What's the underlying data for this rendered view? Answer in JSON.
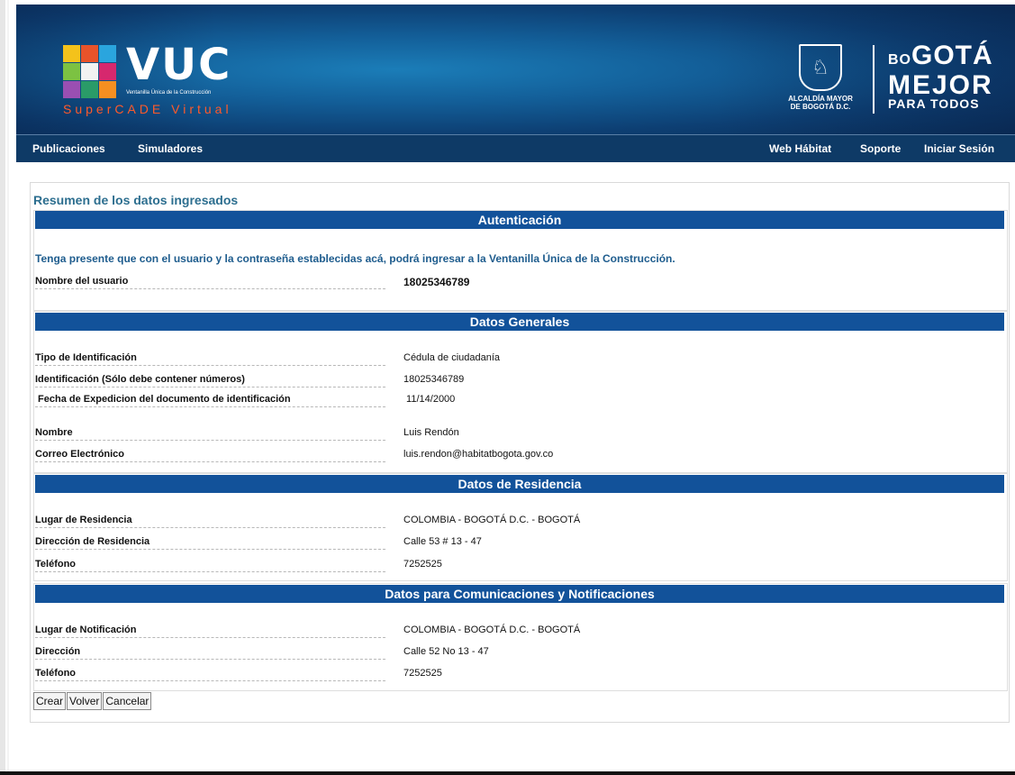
{
  "header": {
    "logo_text": "VUC",
    "logo_subtitle": "Ventanilla Única de la Construcción",
    "logo_tagline": "SuperCADE Virtual",
    "alcaldia": [
      "ALCALDÍA MAYOR",
      "DE BOGOTÁ D.C."
    ],
    "bogota": {
      "line1_small": "BO",
      "line1": "GOTÁ",
      "line2": "MEJOR",
      "line3": "PARA TODOS"
    }
  },
  "nav": {
    "left": [
      "Publicaciones",
      "Simuladores"
    ],
    "right": [
      "Web Hábitat",
      "Soporte",
      "Iniciar Sesión"
    ]
  },
  "summary_title": "Resumen de los datos ingresados",
  "sections": {
    "auth": {
      "title": "Autenticación",
      "notice": "Tenga presente que con el usuario y la contraseña establecidas acá, podrá ingresar a la Ventanilla Única de la Construcción.",
      "rows": [
        {
          "label": "Nombre del usuario",
          "value": "18025346789"
        }
      ]
    },
    "general": {
      "title": "Datos Generales",
      "rows": [
        {
          "label": "Tipo de Identificación",
          "value": "Cédula de ciudadanía"
        },
        {
          "label": "Identificación (Sólo debe contener números)",
          "value": "18025346789"
        },
        {
          "label": " Fecha de Expedicion del documento de identificación",
          "value": " 11/14/2000"
        },
        {
          "label": "Nombre",
          "value": "Luis Rendón"
        },
        {
          "label": "Correo Electrónico",
          "value": "luis.rendon@habitatbogota.gov.co"
        }
      ]
    },
    "residence": {
      "title": "Datos de Residencia",
      "rows": [
        {
          "label": "Lugar de Residencia",
          "value": "COLOMBIA - BOGOTÁ D.C. - BOGOTÁ"
        },
        {
          "label": "Dirección de Residencia",
          "value": "Calle 53 # 13 - 47"
        },
        {
          "label": "Teléfono",
          "value": "7252525"
        }
      ]
    },
    "notifications": {
      "title": "Datos para Comunicaciones y Notificaciones",
      "rows": [
        {
          "label": "Lugar de Notificación",
          "value": "COLOMBIA - BOGOTÁ D.C. - BOGOTÁ"
        },
        {
          "label": "Dirección",
          "value": "Calle 52 No 13 - 47"
        },
        {
          "label": "Teléfono",
          "value": "7252525"
        }
      ]
    }
  },
  "buttons": {
    "create": "Crear",
    "back": "Volver",
    "cancel": "Cancelar"
  },
  "colors": {
    "section_bar": "#12529a",
    "nav_bg": "#0e3a66",
    "title_teal": "#2c6e8f",
    "tagline": "#ff5a2a"
  }
}
